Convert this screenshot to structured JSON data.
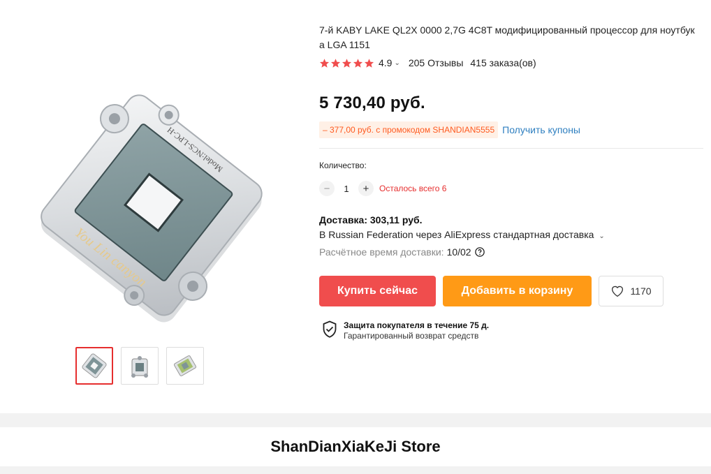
{
  "product": {
    "title": "7-й KABY LAKE QL2X 0000 2,7G 4C8T модифицированный процессор для ноутбук а LGA 1151",
    "rating": "4.9",
    "rating_stars": 5,
    "reviews": "205 Отзывы",
    "orders": "415 заказа(ов)",
    "price": "5 730,40 руб.",
    "promo": "– 377,00 руб. с промокодом SHANDIAN5555",
    "coupon_link": "Получить купоны"
  },
  "gallery": {
    "main_image_text": [
      "You Lin canyon",
      "Model:NCS-LPC-H"
    ],
    "thumbnails": [
      "thumbnail-1",
      "thumbnail-2",
      "thumbnail-3"
    ],
    "selected_thumbnail": 1
  },
  "quantity": {
    "label": "Количество:",
    "minus": "−",
    "plus": "+",
    "value": "1",
    "stock": "Осталось всего 6"
  },
  "shipping": {
    "price": "Доставка: 303,11 руб.",
    "method": "В Russian Federation через AliExpress стандартная доставка",
    "time_label": "Расчётное время доставки:",
    "time_value": "10/02"
  },
  "actions": {
    "buy": "Купить сейчас",
    "cart": "Добавить в корзину",
    "wishlist_count": "1170"
  },
  "protection": {
    "title": "Защита покупателя в течение 75 д.",
    "subtitle": "Гарантированный возврат средств"
  },
  "store": {
    "name": "ShanDianXiaKeJi Store"
  },
  "colors": {
    "buy": "#f04d4d",
    "cart": "#ff9a16",
    "star": "#f04d4d",
    "promo_text": "#ff5a1f",
    "link": "#2e7fc0",
    "stock": "#e62e2e"
  }
}
